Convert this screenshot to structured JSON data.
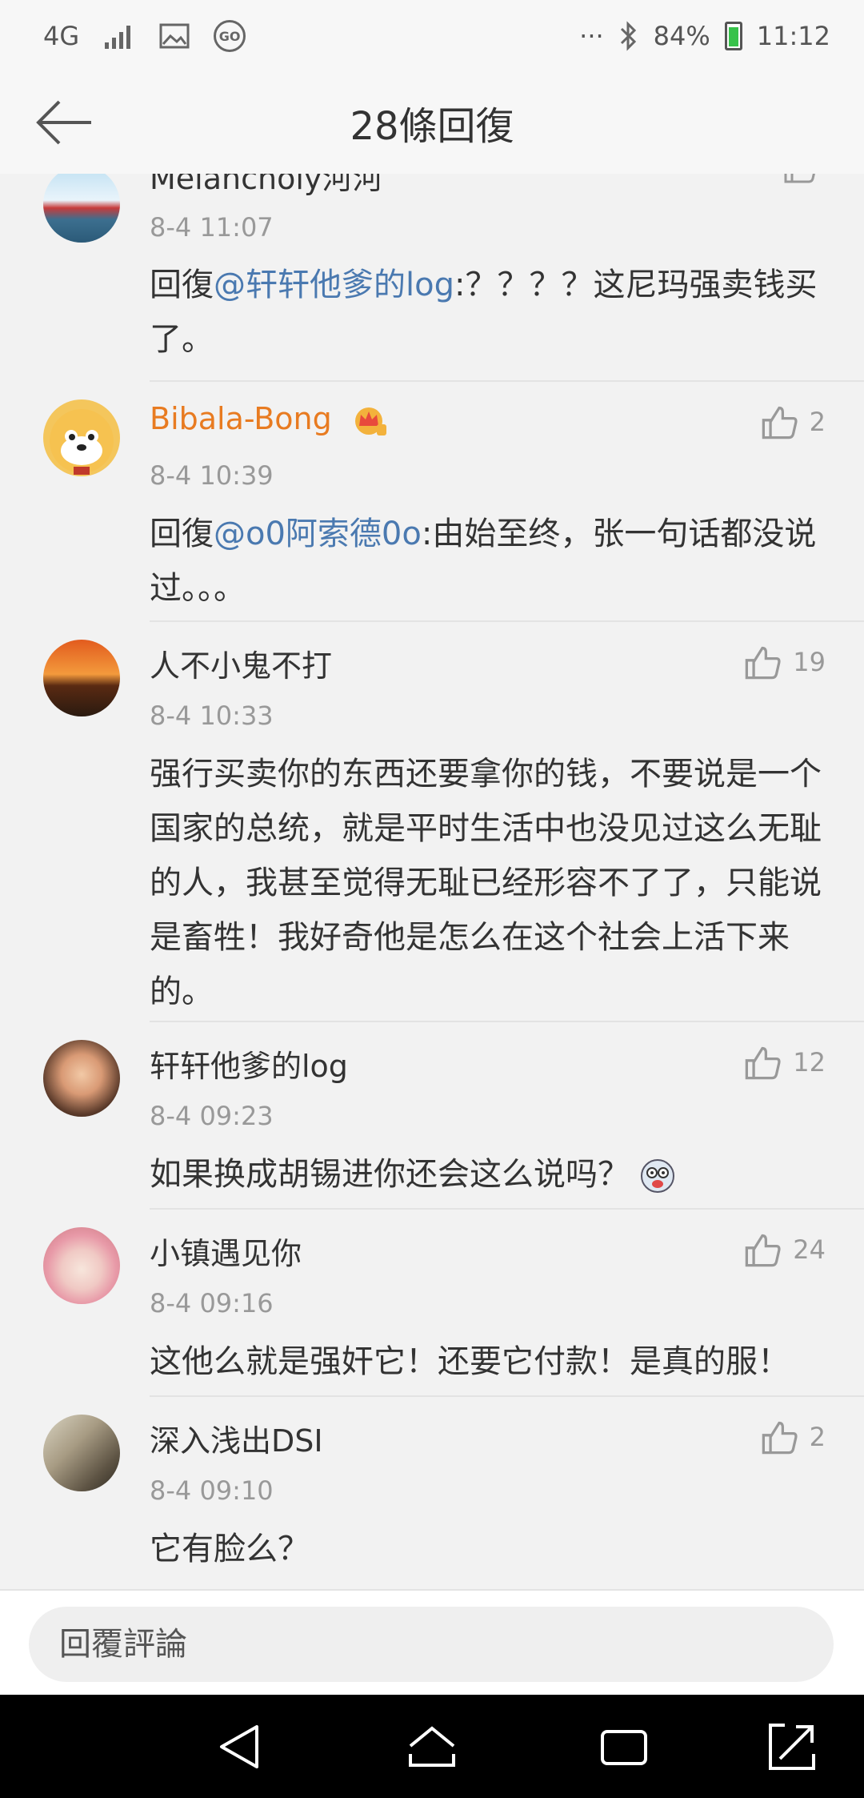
{
  "status_bar": {
    "network": "4G",
    "battery_text": "84%",
    "time": "11:12",
    "more": "···"
  },
  "header": {
    "title": "28條回復"
  },
  "comments": [
    {
      "username": "Melancholy河河",
      "time": "8-4 11:07",
      "reply_prefix": "回復",
      "mention": "@轩轩他爹的log",
      "text": ":？？？？这尼玛强卖钱买了。",
      "likes": ""
    },
    {
      "username": "Bibala-Bong",
      "time": "8-4 10:39",
      "reply_prefix": "回復",
      "mention": "@o0阿索德0o",
      "text": ":由始至终，张一句话都没说过。。。",
      "likes": "2"
    },
    {
      "username": "人不小鬼不打",
      "time": "8-4 10:33",
      "text": "强行买卖你的东西还要拿你的钱，不要说是一个国家的总统，就是平时生活中也没见过这么无耻的人，我甚至觉得无耻已经形容不了了，只能说是畜牲！我好奇他是怎么在这个社会上活下来的。",
      "likes": "19"
    },
    {
      "username": "轩轩他爹的log",
      "time": "8-4 09:23",
      "text": "如果换成胡锡进你还会这么说吗？",
      "likes": "12"
    },
    {
      "username": "小镇遇见你",
      "time": "8-4 09:16",
      "text": "这他么就是强奸它！还要它付款！是真的服！",
      "likes": "24"
    },
    {
      "username": "深入浅出DSI",
      "time": "8-4 09:10",
      "text": "它有脸么？",
      "likes": "2"
    }
  ],
  "reply_bar": {
    "placeholder": "回覆評論"
  },
  "icons": {
    "back": "arrow-left-icon",
    "like": "thumbs-up-icon",
    "crown": "vip-crown-icon",
    "nav_back": "triangle-back-icon",
    "nav_home": "home-icon",
    "nav_recents": "recents-icon",
    "nav_expand": "expand-icon"
  },
  "colors": {
    "vip_name": "#e87b21",
    "mention": "#4a79b0",
    "timestamp": "#999999",
    "battery": "#37c24a"
  }
}
